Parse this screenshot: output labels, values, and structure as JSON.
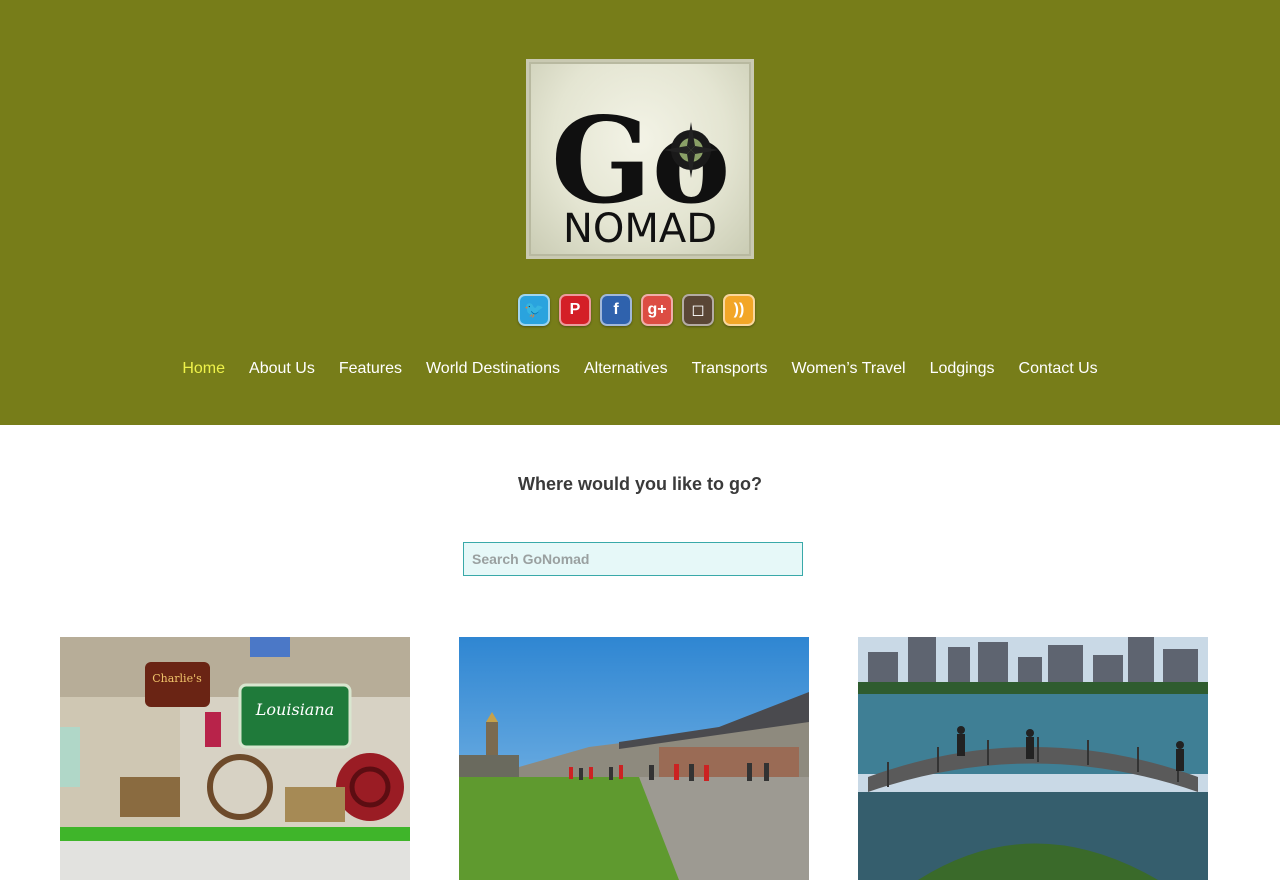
{
  "header": {
    "logo": {
      "text_top": "Go",
      "text_bottom": "NOMAD"
    },
    "background_color": "#777d19"
  },
  "social": [
    {
      "name": "twitter-icon",
      "glyph": "🐦",
      "color": "#2aa3de"
    },
    {
      "name": "pinterest-icon",
      "glyph": "P",
      "color": "#d41f27"
    },
    {
      "name": "facebook-icon",
      "glyph": "f",
      "color": "#2f62ad"
    },
    {
      "name": "google-plus-icon",
      "glyph": "g+",
      "color": "#dc4d43"
    },
    {
      "name": "instagram-icon",
      "glyph": "◻",
      "color": "#5a4636"
    },
    {
      "name": "rss-icon",
      "glyph": "))",
      "color": "#f2a627"
    }
  ],
  "nav": {
    "items": [
      {
        "label": "Home",
        "active": true
      },
      {
        "label": "About Us"
      },
      {
        "label": "Features"
      },
      {
        "label": "World Destinations"
      },
      {
        "label": "Alternatives"
      },
      {
        "label": "Transports"
      },
      {
        "label": "Women’s Travel"
      },
      {
        "label": "Lodgings"
      },
      {
        "label": "Contact Us"
      }
    ]
  },
  "search": {
    "question": "Where would you like to go?",
    "placeholder": "Search GoNomad",
    "value": ""
  },
  "cards": [
    {
      "name": "louisiana-exhibit-image",
      "sign1": "Charlie's",
      "sign2": "Louisiana"
    },
    {
      "name": "fortress-courtyard-image"
    },
    {
      "name": "city-waterfront-image"
    }
  ]
}
